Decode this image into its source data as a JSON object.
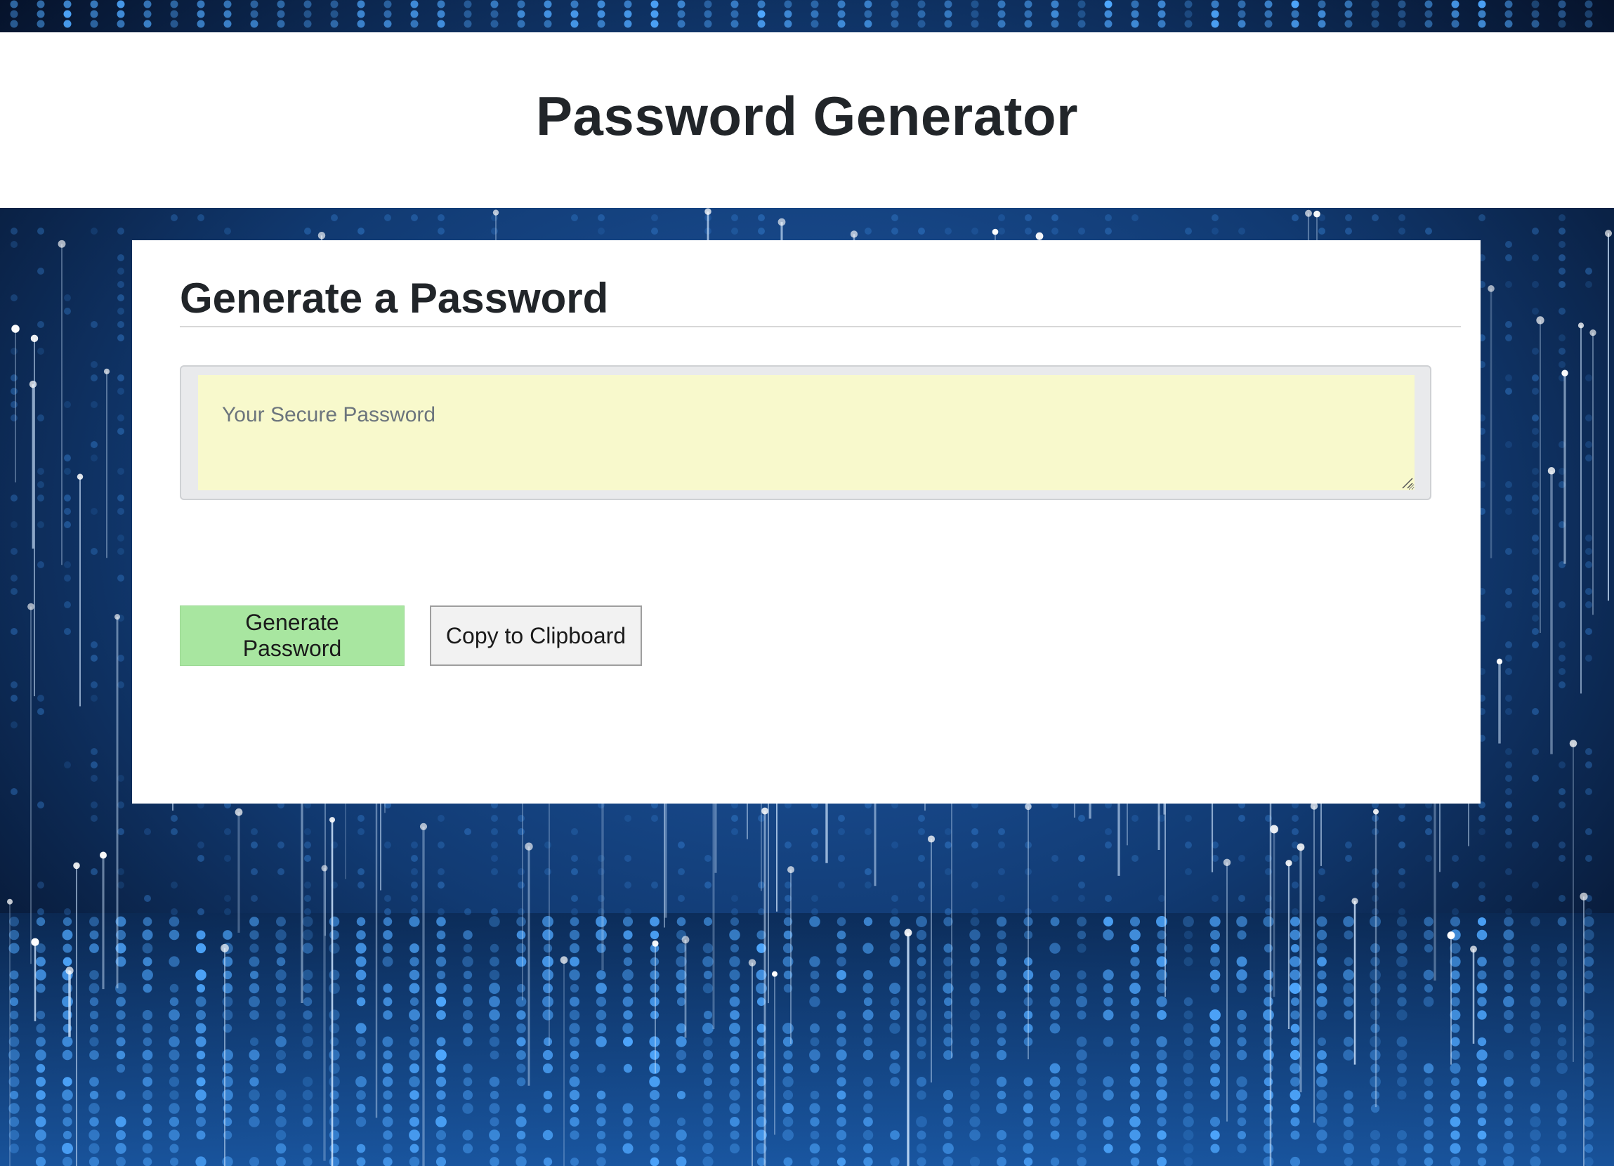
{
  "page": {
    "title": "Password Generator"
  },
  "card": {
    "heading": "Generate a Password",
    "password_field": {
      "value": "",
      "placeholder": "Your Secure Password"
    },
    "buttons": {
      "generate_label": "Generate Password",
      "copy_label": "Copy to Clipboard"
    }
  },
  "colors": {
    "background": "#0a1f3d",
    "header_background": "#ffffff",
    "textarea_background": "#f8f9cc",
    "generate_button": "#a8e6a0",
    "copy_button": "#f2f2f2",
    "text": "#212529"
  },
  "icons": {
    "resize": "resize-handle-icon"
  }
}
